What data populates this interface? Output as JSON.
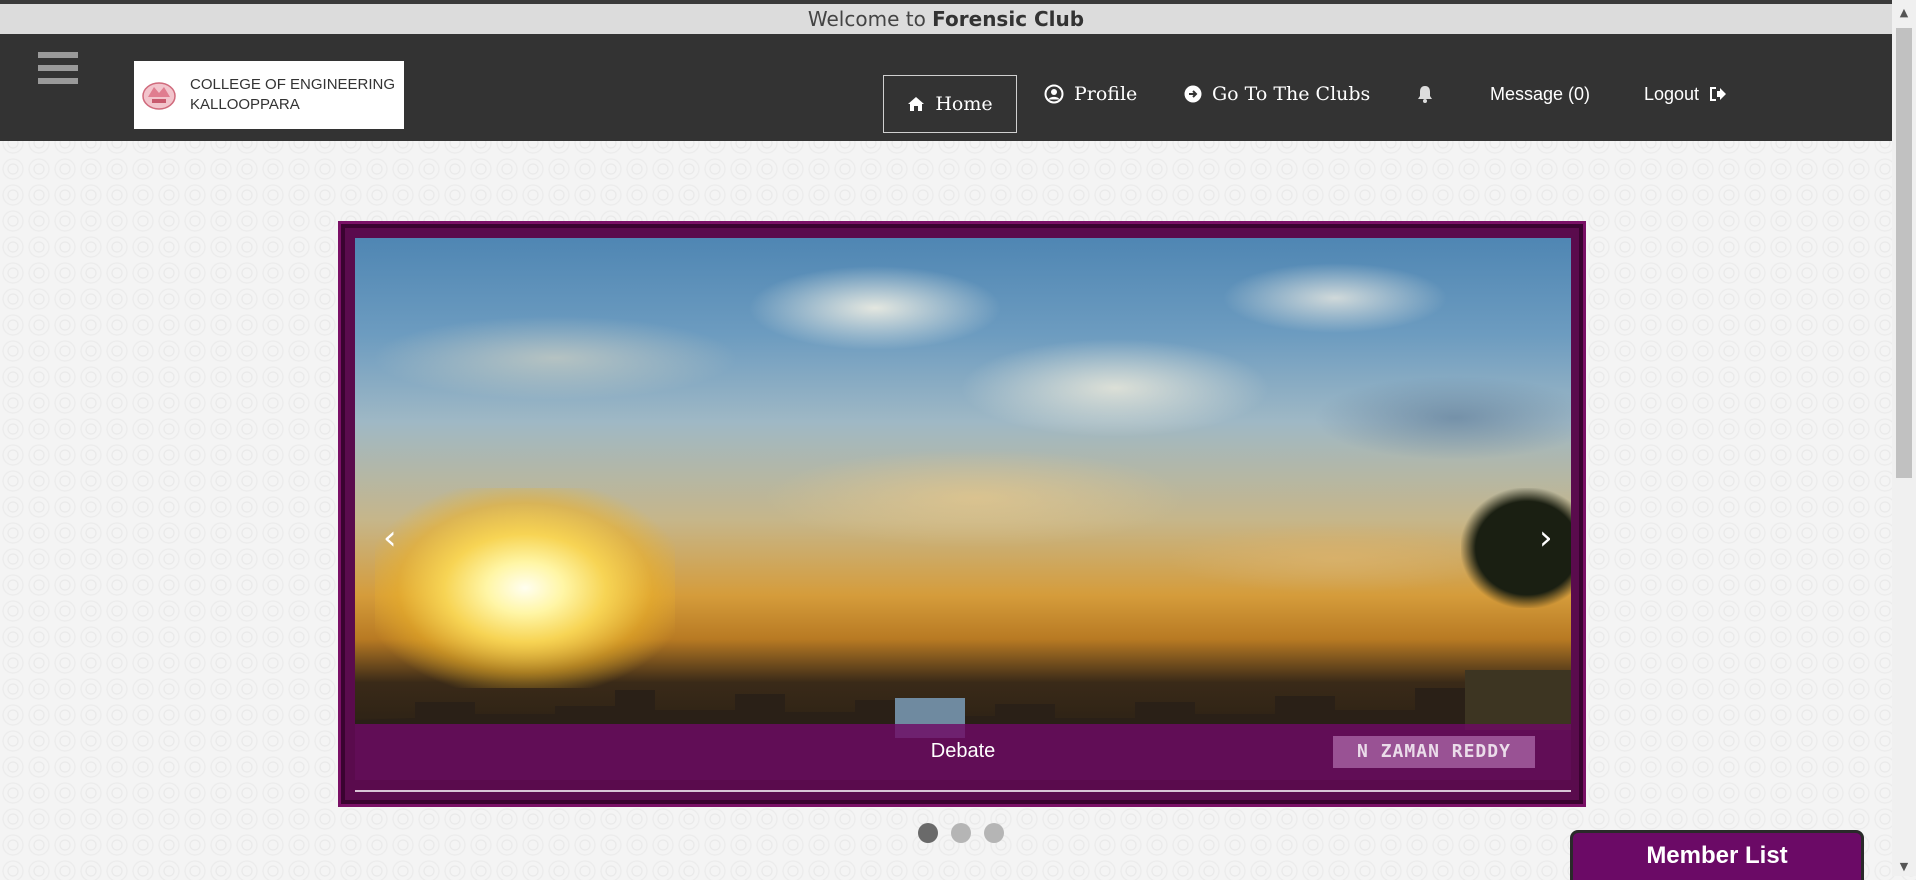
{
  "welcome": {
    "prefix": "Welcome to",
    "club": "Forensic Club"
  },
  "header": {
    "logo_line1": "COLLEGE OF ENGINEERING",
    "logo_line2": "KALLOOPPARA",
    "nav": {
      "home": "Home",
      "profile": "Profile",
      "clubs": "Go To The Clubs",
      "message": "Message (0)",
      "logout": "Logout"
    }
  },
  "carousel": {
    "caption": "Debate",
    "watermark": "N ZAMAN REDDY",
    "prev_arrow": "‹",
    "next_arrow": "›",
    "slide_count": 3,
    "active_slide": 1
  },
  "member_list": {
    "label": "Member List"
  },
  "colors": {
    "navbar": "#333333",
    "accent": "#6b0a66",
    "frame": "#5a0b4d"
  }
}
